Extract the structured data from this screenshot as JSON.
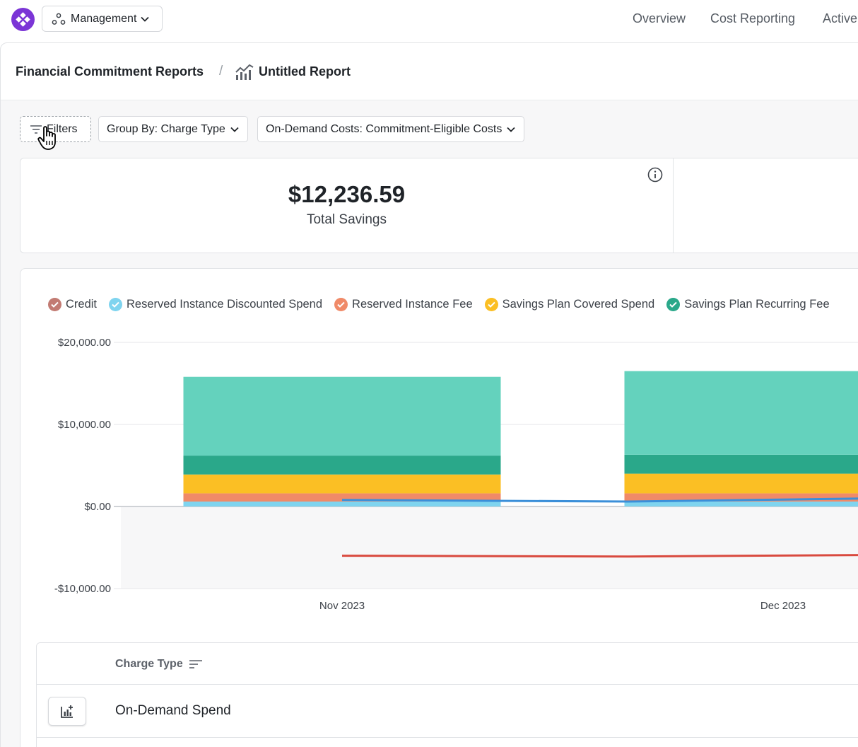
{
  "topbar": {
    "org_selector_label": "Management",
    "nav": [
      "Overview",
      "Cost Reporting",
      "Active"
    ]
  },
  "breadcrumb": {
    "root": "Financial Commitment Reports",
    "separator": "/",
    "current": "Untitled Report"
  },
  "toolbar": {
    "filters_label": "Filters",
    "group_by_label": "Group By: Charge Type",
    "on_demand_label": "On-Demand Costs: Commitment-Eligible Costs"
  },
  "summary": {
    "total_value": "$12,236.59",
    "total_label": "Total Savings"
  },
  "legend": [
    {
      "label": "Credit",
      "color": "#c27b73"
    },
    {
      "label": "Reserved Instance Discounted Spend",
      "color": "#7fd4ef"
    },
    {
      "label": "Reserved Instance Fee",
      "color": "#f08a68"
    },
    {
      "label": "Savings Plan Covered Spend",
      "color": "#fbbf24"
    },
    {
      "label": "Savings Plan Recurring Fee",
      "color": "#2aa88a"
    }
  ],
  "chart_data": {
    "type": "bar",
    "stacked": true,
    "categories": [
      "Nov 2023",
      "Dec 2023"
    ],
    "ylim": [
      -10000,
      20000
    ],
    "y_ticks": [
      {
        "value": 20000,
        "label": "$20,000.00"
      },
      {
        "value": 10000,
        "label": "$10,000.00"
      },
      {
        "value": 0,
        "label": "$0.00"
      },
      {
        "value": -10000,
        "label": "-$10,000.00"
      }
    ],
    "series": [
      {
        "name": "Reserved Instance Discounted Spend",
        "color": "#7fd4ef",
        "values": [
          600,
          600
        ]
      },
      {
        "name": "Reserved Instance Fee",
        "color": "#f08a68",
        "values": [
          1000,
          1000
        ]
      },
      {
        "name": "Savings Plan Covered Spend",
        "color": "#fbbf24",
        "values": [
          2300,
          2400
        ]
      },
      {
        "name": "Savings Plan Recurring Fee",
        "color": "#2aa88a",
        "values": [
          2300,
          2300
        ]
      },
      {
        "value_key": "top",
        "color": "#64d2bd",
        "values": [
          9600,
          10200
        ]
      }
    ],
    "lines": [
      {
        "color": "#3b8fd9",
        "values": [
          800,
          600,
          1000
        ]
      },
      {
        "name": "Credit",
        "color": "#d94a3f",
        "values": [
          -6000,
          -6100,
          -5900
        ]
      }
    ],
    "grid": true
  },
  "table": {
    "header": "Charge Type",
    "rows": [
      "On-Demand Spend"
    ]
  },
  "colors": {
    "brand": "#7b35d6",
    "border": "#e1e3e6"
  }
}
